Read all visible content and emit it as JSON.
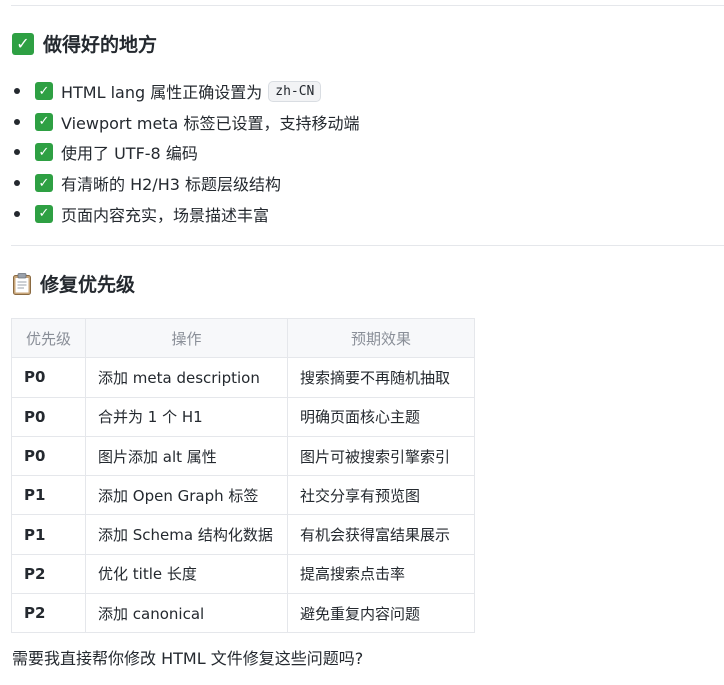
{
  "good_section": {
    "title": "做得好的地方",
    "items": [
      {
        "text": "HTML lang 属性正确设置为",
        "code": "zh-CN"
      },
      {
        "text": "Viewport meta 标签已设置，支持移动端"
      },
      {
        "text": "使用了 UTF-8 编码"
      },
      {
        "text": "有清晰的 H2/H3 标题层级结构"
      },
      {
        "text": "页面内容充实，场景描述丰富"
      }
    ]
  },
  "priority_section": {
    "title": "修复优先级",
    "headers": [
      "优先级",
      "操作",
      "预期效果"
    ],
    "rows": [
      {
        "priority": "P0",
        "action": "添加 meta description",
        "effect": "搜索摘要不再随机抽取"
      },
      {
        "priority": "P0",
        "action": "合并为 1 个 H1",
        "effect": "明确页面核心主题"
      },
      {
        "priority": "P0",
        "action": "图片添加 alt 属性",
        "effect": "图片可被搜索引擎索引"
      },
      {
        "priority": "P1",
        "action": "添加 Open Graph 标签",
        "effect": "社交分享有预览图"
      },
      {
        "priority": "P1",
        "action": "添加 Schema 结构化数据",
        "effect": "有机会获得富结果展示"
      },
      {
        "priority": "P2",
        "action": "优化 title 长度",
        "effect": "提高搜索点击率"
      },
      {
        "priority": "P2",
        "action": "添加 canonical",
        "effect": "避免重复内容问题"
      }
    ]
  },
  "question": "需要我直接帮你修改 HTML 文件修复这些问题吗?",
  "icons": {
    "check": "check-mark-icon",
    "clipboard": "clipboard-icon"
  },
  "colors": {
    "check_green": "#2ea043",
    "text": "#24292f",
    "header_text": "#8a8f98"
  }
}
